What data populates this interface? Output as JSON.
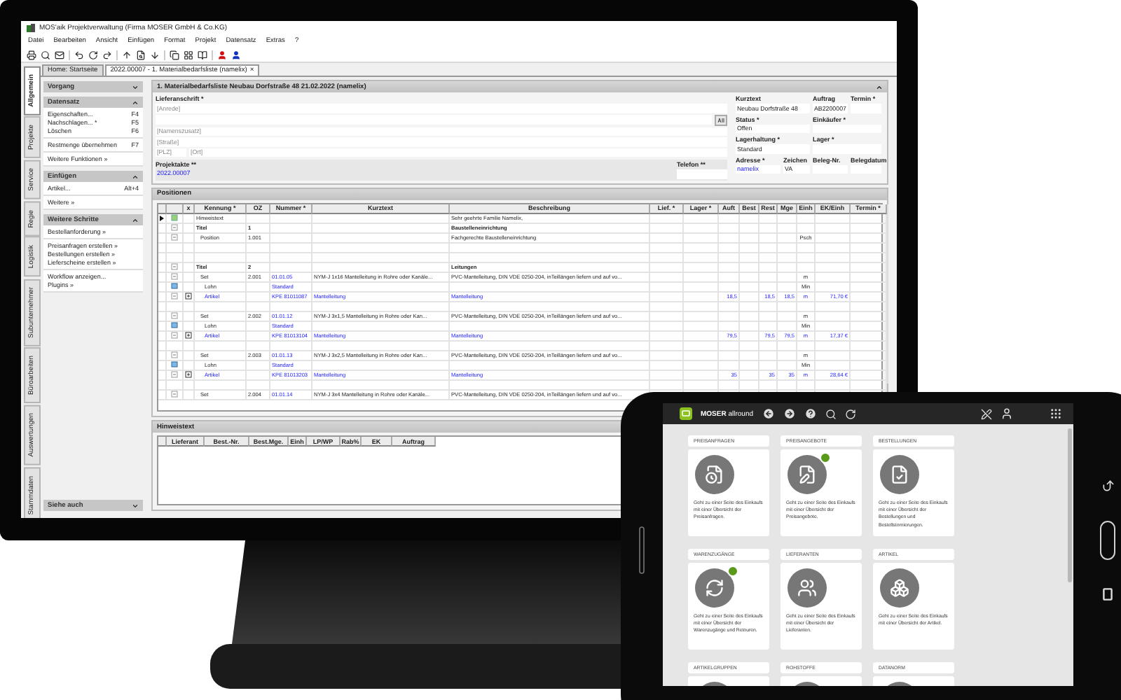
{
  "window": {
    "title": "MOS'aik Projektverwaltung (Firma MOSER GmbH & Co.KG)"
  },
  "menu": [
    "Datei",
    "Bearbeiten",
    "Ansicht",
    "Einfügen",
    "Format",
    "Projekt",
    "Datensatz",
    "Extras",
    "?"
  ],
  "side_tabs": [
    {
      "label": "Allgemein",
      "selected": true
    },
    {
      "label": "Projekte",
      "selected": false
    },
    {
      "label": "Service",
      "selected": false
    },
    {
      "label": "Regie",
      "selected": false
    },
    {
      "label": "Logistik",
      "selected": false
    },
    {
      "label": "Subunternehmer",
      "selected": false
    },
    {
      "label": "Büroarbeiten",
      "selected": false
    },
    {
      "label": "Auswertungen",
      "selected": false
    },
    {
      "label": "Stammdaten",
      "selected": false
    }
  ],
  "doc_tabs": [
    {
      "label": "Home: Startseite",
      "selected": false
    },
    {
      "label": "2022.00007 - 1. Materialbedarfsliste (namelix)",
      "selected": true,
      "close": "×"
    }
  ],
  "task_panel": {
    "sections": [
      {
        "title": "Vorgang",
        "expanded": false
      },
      {
        "title": "Datensatz",
        "expanded": true,
        "groups": [
          [
            {
              "label": "Eigenschaften...",
              "shortcut": "F4"
            },
            {
              "label": "Nachschlagen... *",
              "shortcut": "F5"
            },
            {
              "label": "Löschen",
              "shortcut": "F6"
            }
          ],
          [
            {
              "label": "Restmenge übernehmen",
              "shortcut": "F7"
            }
          ],
          [
            {
              "label": "Weitere Funktionen »"
            }
          ]
        ]
      },
      {
        "title": "Einfügen",
        "expanded": true,
        "groups": [
          [
            {
              "label": "Artikel...",
              "shortcut": "Alt+4"
            }
          ],
          [
            {
              "label": "Weitere »"
            }
          ]
        ]
      },
      {
        "title": "Weitere Schritte",
        "expanded": true,
        "groups": [
          [
            {
              "label": "Bestellanforderung »"
            }
          ],
          [
            {
              "label": "Preisanfragen erstellen »"
            },
            {
              "label": "Bestellungen erstellen »"
            },
            {
              "label": "Lieferscheine erstellen »"
            }
          ],
          [
            {
              "label": "Workflow anzeigen..."
            },
            {
              "label": "Plugins »"
            }
          ]
        ]
      }
    ],
    "footer": {
      "title": "Siehe auch",
      "expanded": false
    }
  },
  "form": {
    "title": "1. Materialbedarfsliste Neubau Dorfstraße 48 21.02.2022 (namelix)",
    "expanded": true,
    "address_label": "Lieferanschrift *",
    "address_fields": [
      {
        "kind": "line",
        "placeholder": "[Anrede]"
      },
      {
        "kind": "lookup"
      },
      {
        "kind": "line",
        "placeholder": "[Namenszusatz]"
      },
      {
        "kind": "line",
        "placeholder": "[Straße]"
      },
      {
        "kind": "city",
        "placeholder": "[PLZ]",
        "placeholder_2": "[Ort]"
      }
    ],
    "project_file": {
      "label": "Projektakte **",
      "value": "2022.00007"
    },
    "phone": {
      "label": "Telefon **"
    },
    "fields": [
      {
        "label": "Kurztext",
        "value": "Neubau Dorfstraße 48",
        "link": false
      },
      {
        "label": "Auftrag",
        "value": "AB2200007",
        "link": false
      },
      {
        "label": "Termin *",
        "link": false
      },
      {
        "label": "Status *",
        "value": "Offen",
        "link": false
      },
      {
        "label": "Einkäufer *",
        "link": false
      },
      {
        "label": "Lagerhaltung *",
        "value": "Standard",
        "link": false
      },
      {
        "label": "Lager *",
        "link": false
      },
      {
        "label": "Adresse *",
        "value": "namelix",
        "link": true
      },
      {
        "label": "Zeichen",
        "value": "VA",
        "link": false
      },
      {
        "label": "Beleg-Nr.",
        "link": false
      },
      {
        "label": "Belegdatum",
        "link": false
      }
    ]
  },
  "positions": {
    "title": "Positionen",
    "columns": [
      "x",
      "Kennung *",
      "OZ",
      "Nummer *",
      "Kurztext",
      "Beschreibung",
      "Lief. *",
      "Lager *",
      "Auft",
      "Best",
      "Rest",
      "Mge",
      "Einh",
      "EK/Einh",
      "Termin *"
    ],
    "rows": [
      {
        "kind": "hint",
        "selected": true,
        "kennung": "Hinweistext",
        "beschreibung": "Sehr geehrte Familie Namelix,"
      },
      {
        "kind": "title",
        "selected": false,
        "kennung": "Titel",
        "oz": "1",
        "beschreibung": "Baustelleneinrichtung"
      },
      {
        "kind": "position",
        "selected": false,
        "kennung": "Position",
        "oz": "1.001",
        "beschreibung": "Fachgerechte Baustelleneinrichtung",
        "einh": "Psch"
      },
      {
        "kind": "empty",
        "selected": false
      },
      {
        "kind": "empty",
        "selected": false
      },
      {
        "kind": "title",
        "selected": false,
        "kennung": "Titel",
        "oz": "2",
        "beschreibung": "Leitungen"
      },
      {
        "kind": "set",
        "selected": false,
        "kennung": "Set",
        "oz": "2.001",
        "nummer": "01.01.05",
        "kurztext": "NYM-J 1x16 Mantelleitung in Rohre oder Kanäle...",
        "beschreibung": "PVC-Mantelleitung, DIN VDE 0250-204, inTeillängen liefern und auf vo...",
        "einh": "m"
      },
      {
        "kind": "labor",
        "selected": false,
        "kennung": "Lohn",
        "nummer": "Standard",
        "einh": "Min"
      },
      {
        "kind": "article",
        "selected": false,
        "kennung": "Artikel",
        "nummer": "KPE 81011087",
        "kurztext": "Mantelleitung",
        "beschreibung": "Mantelleitung",
        "auft": "18,5",
        "rest": "18,5",
        "mge": "18,5",
        "einh": "m",
        "ek": "71,70 €"
      },
      {
        "kind": "empty",
        "selected": false
      },
      {
        "kind": "set",
        "selected": false,
        "kennung": "Set",
        "oz": "2.002",
        "nummer": "01.01.12",
        "kurztext": "NYM-J 3x1,5 Mantelleitung in Rohre oder Kan...",
        "beschreibung": "PVC-Mantelleitung, DIN VDE 0250-204, inTeillängen liefern und auf vo...",
        "einh": "m"
      },
      {
        "kind": "labor",
        "selected": false,
        "kennung": "Lohn",
        "nummer": "Standard",
        "einh": "Min"
      },
      {
        "kind": "article",
        "selected": false,
        "kennung": "Artikel",
        "nummer": "KPE 81013104",
        "kurztext": "Mantelleitung",
        "beschreibung": "Mantelleitung",
        "auft": "79,5",
        "rest": "79,5",
        "mge": "79,5",
        "einh": "m",
        "ek": "17,37 €"
      },
      {
        "kind": "empty",
        "selected": false
      },
      {
        "kind": "set",
        "selected": false,
        "kennung": "Set",
        "oz": "2.003",
        "nummer": "01.01.13",
        "kurztext": "NYM-J 3x2,5 Mantelleitung in Rohre oder Kan...",
        "beschreibung": "PVC-Mantelleitung, DIN VDE 0250-204, inTeillängen liefern und auf vo...",
        "einh": "m"
      },
      {
        "kind": "labor",
        "selected": false,
        "kennung": "Lohn",
        "nummer": "Standard",
        "einh": "Min"
      },
      {
        "kind": "article",
        "selected": false,
        "kennung": "Artikel",
        "nummer": "KPE 81013203",
        "kurztext": "Mantelleitung",
        "beschreibung": "Mantelleitung",
        "auft": "35",
        "rest": "35",
        "mge": "35",
        "einh": "m",
        "ek": "28,64 €"
      },
      {
        "kind": "empty",
        "selected": false
      },
      {
        "kind": "set",
        "selected": false,
        "kennung": "Set",
        "oz": "2.004",
        "nummer": "01.01.14",
        "kurztext": "NYM-J 3x4 Mantelleitung in Rohre oder Kanäle...",
        "beschreibung": "PVC-Mantelleitung, DIN VDE 0250-204, inTeillängen liefern und auf vo..."
      }
    ]
  },
  "hint_panel": {
    "title": "Hinweistext",
    "columns": [
      "Lieferant",
      "Best.-Nr.",
      "Best.Mge.",
      "Einh",
      "LP/WP",
      "Rab%",
      "EK",
      "Auftrag"
    ]
  },
  "tablet": {
    "app_name": "**MOSER** allround",
    "cards": [
      {
        "kind": "inquiry",
        "title": "PREISANFRAGEN",
        "description": "Geht zu einer Seite des Einkaufs mit einer Übersicht der Preisanfragen.",
        "badge": false
      },
      {
        "kind": "offer",
        "title": "PREISANGEBOTE",
        "description": "Geht zu einer Seite des Einkaufs mit einer Übersicht der Preisangebote.",
        "badge": true
      },
      {
        "kind": "order",
        "title": "BESTELLUNGEN",
        "description": "Geht zu einer Seite des Einkaufs mit einer Übersicht der Bestellungen und Bestellstornierungen.",
        "badge": false
      },
      {
        "kind": "receipt",
        "title": "WARENZUGÄNGE",
        "description": "Geht zu einer Seite des Einkaufs mit einer Übersicht der Warenzugänge und Retouren.",
        "badge": true
      },
      {
        "kind": "supplier",
        "title": "LIEFERANTEN",
        "description": "Geht zu einer Seite des Einkaufs mit einer Übersicht der Lieferanten.",
        "badge": false
      },
      {
        "kind": "article",
        "title": "ARTIKEL",
        "description": "Geht zu einer Seite des Einkaufs mit einer Übersicht der Artikel.",
        "badge": false
      },
      {
        "kind": "group",
        "title": "ARTIKELGRUPPEN",
        "badge": false
      },
      {
        "kind": "material",
        "title": "ROHSTOFFE",
        "badge": false
      },
      {
        "kind": "datanorm",
        "title": "DATANORM",
        "badge": false
      }
    ]
  }
}
